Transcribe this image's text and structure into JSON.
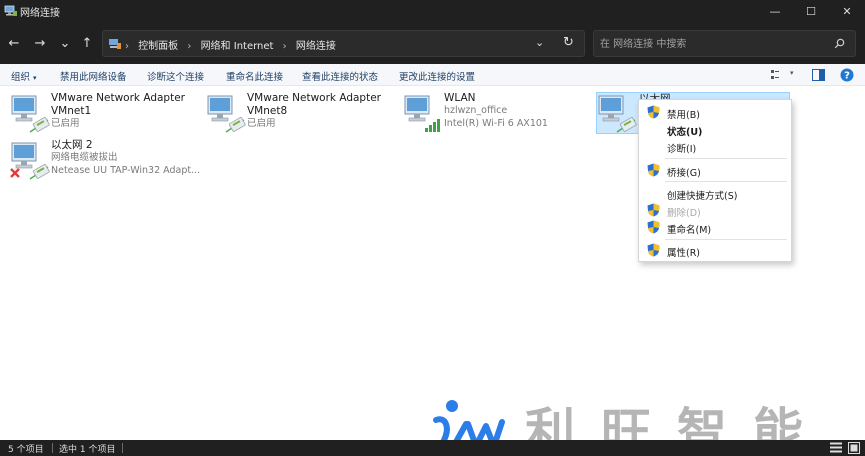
{
  "window": {
    "title": "网络连接",
    "minimize": "—",
    "maximize": "☐",
    "close": "✕"
  },
  "nav": {
    "back": "←",
    "forward": "→",
    "history": "⌄",
    "up": "↑",
    "breadcrumb": [
      "控制面板",
      "网络和 Internet",
      "网络连接"
    ],
    "dropdown": "⌄",
    "refresh": "↻",
    "search_placeholder": "在 网络连接 中搜索"
  },
  "commands": [
    "组织",
    "禁用此网络设备",
    "诊断这个连接",
    "重命名此连接",
    "查看此连接的状态",
    "更改此连接的设置"
  ],
  "adapters": [
    {
      "name": "VMware Network Adapter VMnet1",
      "line1": "VMware Network Adapter",
      "line2": "VMnet1",
      "line3": "已启用",
      "type": "ethernet"
    },
    {
      "name": "VMware Network Adapter VMnet8",
      "line1": "VMware Network Adapter",
      "line2": "VMnet8",
      "line3": "已启用",
      "type": "ethernet"
    },
    {
      "name": "WLAN",
      "line1": "WLAN",
      "line2": "hzlwzn_office",
      "line3": "Intel(R) Wi-Fi 6 AX101",
      "type": "wifi"
    },
    {
      "name": "以太网",
      "line1": "以太网",
      "type": "ethernet",
      "selected": true
    },
    {
      "name": "以太网 2",
      "line1": "以太网 2",
      "line2": "网络电缆被拔出",
      "line3": "Netease UU TAP-Win32 Adapt...",
      "type": "disconnected"
    }
  ],
  "context_menu": [
    {
      "label": "禁用(B)",
      "shield": true
    },
    {
      "label": "状态(U)",
      "bold": true
    },
    {
      "label": "诊断(I)"
    },
    {
      "label": "桥接(G)",
      "shield": true
    },
    {
      "label": "创建快捷方式(S)"
    },
    {
      "label": "删除(D)",
      "shield": true,
      "disabled": true
    },
    {
      "label": "重命名(M)",
      "shield": true
    },
    {
      "label": "属性(R)",
      "shield": true
    }
  ],
  "status": {
    "count": "5 个项目",
    "selected": "选中 1 个项目"
  },
  "watermark": {
    "text": "利旺智能"
  },
  "colors": {
    "dark": "#202020",
    "accent": "#0078d4",
    "selection": "#cce8ff",
    "command_text": "#1f3f66"
  }
}
